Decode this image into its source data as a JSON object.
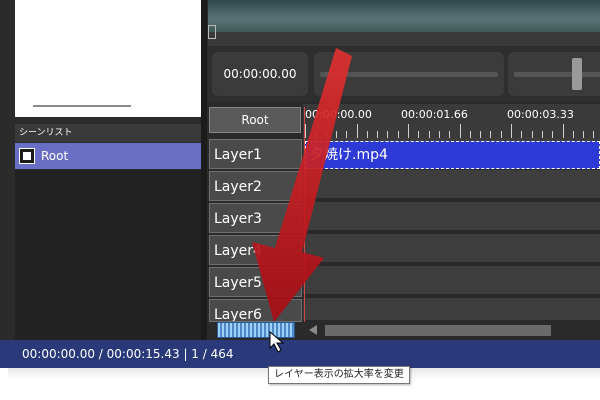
{
  "scene_list": {
    "title": "シーンリスト",
    "items": [
      {
        "label": "Root",
        "icon": "film-icon",
        "selected": true
      }
    ]
  },
  "player": {
    "current_time": "00:00:00.00"
  },
  "timeline": {
    "root_button": "Root",
    "ruler_labels": [
      "00:00:00.00",
      "00:00:01.66",
      "00:00:03.33"
    ],
    "layers": [
      "Layer1",
      "Layer2",
      "Layer3",
      "Layer4",
      "Layer5",
      "Layer6"
    ],
    "clip": {
      "label": "夕焼け.mp4",
      "layer": "Layer1",
      "color": "#2e3ad6"
    }
  },
  "status_bar": {
    "text": "00:00:00.00 / 00:00:15.43  |  1 / 464",
    "color": "#29397a"
  },
  "tooltip": {
    "text": "レイヤー表示の拡大率を変更"
  },
  "accent": {
    "selection": "#6a6fc6",
    "arrow": "#c8141e"
  }
}
